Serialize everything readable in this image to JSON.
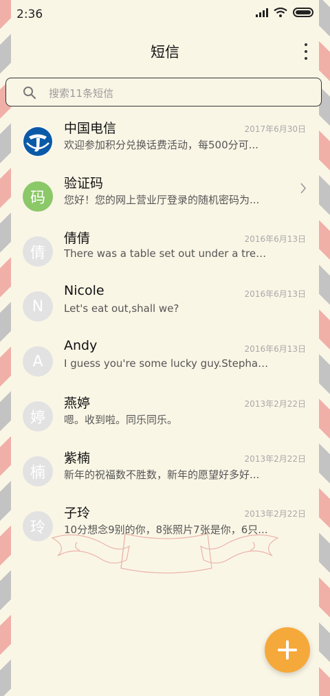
{
  "status": {
    "time": "2:36"
  },
  "header": {
    "title": "短信"
  },
  "search": {
    "placeholder": "搜索11条短信"
  },
  "conversations": [
    {
      "avatar": "",
      "name": "中国电信",
      "date": "2017年6月30日",
      "snippet": "欢迎参加积分兑换话费活动，每500分可..."
    },
    {
      "avatar": "码",
      "name": "验证码",
      "date": "",
      "snippet": "您好！您的网上营业厅登录的随机密码为..."
    },
    {
      "avatar": "倩",
      "name": "倩倩",
      "date": "2016年6月13日",
      "snippet": "There was a table set out under a tree i..."
    },
    {
      "avatar": "N",
      "name": "Nicole",
      "date": "2016年6月13日",
      "snippet": "Let's eat out,shall we?"
    },
    {
      "avatar": "A",
      "name": "Andy",
      "date": "2016年6月13日",
      "snippet": "I guess you're some lucky guy.Stephan..."
    },
    {
      "avatar": "婷",
      "name": "燕婷",
      "date": "2013年2月22日",
      "snippet": "嗯。收到啦。同乐同乐。"
    },
    {
      "avatar": "楠",
      "name": "紫楠",
      "date": "2013年2月22日",
      "snippet": "新年的祝福数不胜数，新年的愿望好多好..."
    },
    {
      "avatar": "玲",
      "name": "子玲",
      "date": "2013年2月22日",
      "snippet": "10分想念9别的你，8张照片7张是你，6只..."
    }
  ],
  "colors": {
    "background": "#faf6e6",
    "fab": "#f6a93b",
    "verify_avatar": "#8bc868",
    "telecom_blue": "#0a5aa8"
  },
  "icons": [
    "signal-icon",
    "wifi-icon",
    "battery-icon",
    "more-icon",
    "search-icon",
    "china-telecom-logo",
    "chevron-right-icon",
    "plus-icon"
  ]
}
